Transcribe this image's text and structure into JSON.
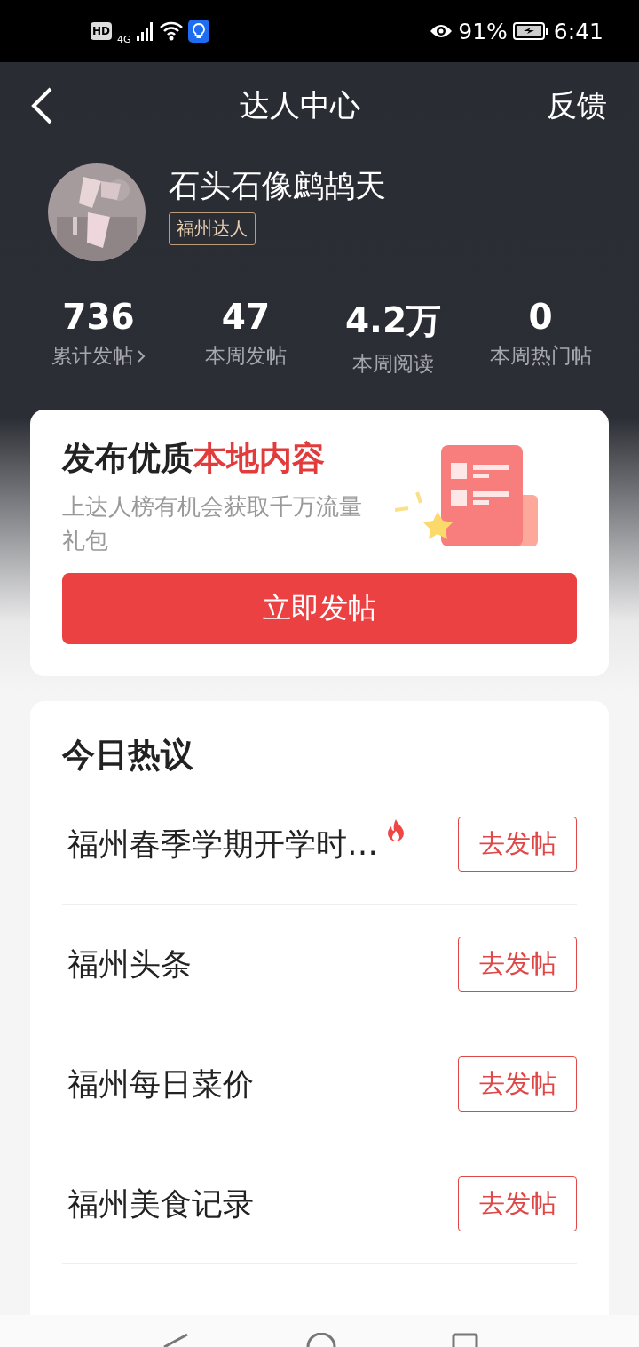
{
  "status_bar": {
    "hd": "HD",
    "network": "4G",
    "battery": "91%",
    "time": "6:41"
  },
  "header": {
    "title": "达人中心",
    "action": "反馈"
  },
  "profile": {
    "name": "石头石像鹧鸪天",
    "badge": "福州达人"
  },
  "stats": [
    {
      "value": "736",
      "label": "累计发帖",
      "link": true
    },
    {
      "value": "47",
      "label": "本周发帖",
      "link": false
    },
    {
      "value": "4.2万",
      "label": "本周阅读",
      "link": false
    },
    {
      "value": "0",
      "label": "本周热门帖",
      "link": false
    }
  ],
  "promo": {
    "title": "发布优质",
    "title_highlight": "本地内容",
    "subtitle": "上达人榜有机会获取千万流量礼包",
    "button": "立即发帖"
  },
  "hot_topics": {
    "title": "今日热议",
    "items": [
      {
        "text": "福州春季学期开学时…",
        "hot": true,
        "button": "去发帖"
      },
      {
        "text": "福州头条",
        "hot": false,
        "button": "去发帖"
      },
      {
        "text": "福州每日菜价",
        "hot": false,
        "button": "去发帖"
      },
      {
        "text": "福州美食记录",
        "hot": false,
        "button": "去发帖"
      }
    ]
  }
}
